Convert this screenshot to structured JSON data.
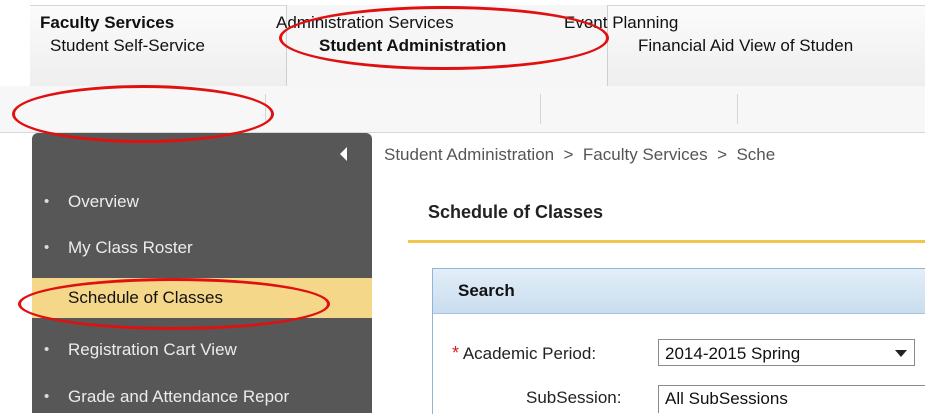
{
  "top_tabs": [
    {
      "label": "Student Self-Service"
    },
    {
      "label": "Student Administration"
    },
    {
      "label": "Financial Aid View of Studen"
    }
  ],
  "sub_nav": [
    {
      "label": "Faculty Services"
    },
    {
      "label": "Administration Services"
    },
    {
      "label": "Event Planning"
    }
  ],
  "sidebar": {
    "items": [
      {
        "label": "Overview"
      },
      {
        "label": "My Class Roster"
      },
      {
        "label": "Schedule of Classes"
      },
      {
        "label": "Registration Cart View"
      },
      {
        "label": "Grade and Attendance Repor"
      }
    ]
  },
  "breadcrumb": "Student Administration  >  Faculty Services  >  Sche",
  "content": {
    "title": "Schedule of Classes",
    "search": {
      "header": "Search",
      "academic_period_label": "Academic Period:",
      "academic_period_value": "2014-2015 Spring",
      "subsession_label": "SubSession:",
      "subsession_value": "All SubSessions",
      "required_marker": "*"
    }
  },
  "colors": {
    "sidebar_bg": "#575757",
    "active_item_bg": "#f5d78a",
    "title_underline": "#f2c64b",
    "search_header": "#c9ddef",
    "annotation_red": "#e01010"
  }
}
